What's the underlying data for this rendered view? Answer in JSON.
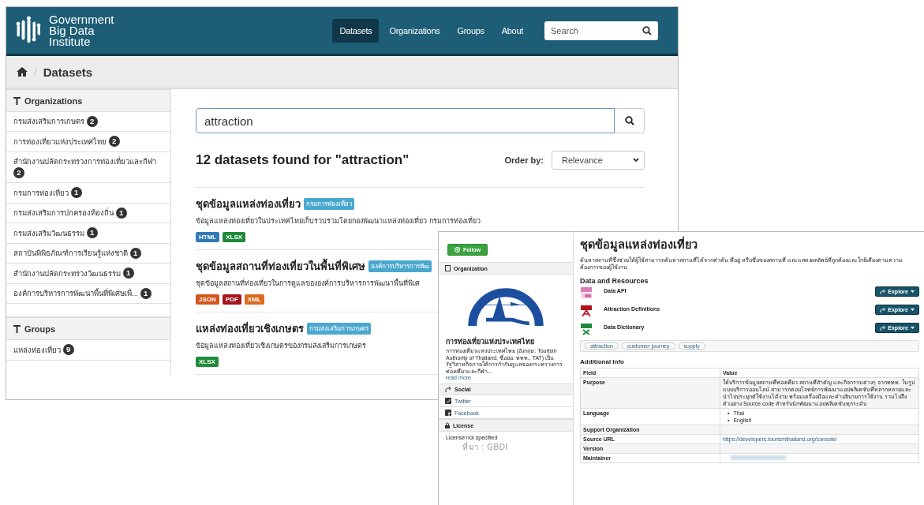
{
  "search_page": {
    "logo_lines": [
      "Government",
      "Big Data",
      "Institute"
    ],
    "nav": [
      {
        "label": "Datasets",
        "selected": true
      },
      {
        "label": "Organizations",
        "selected": false
      },
      {
        "label": "Groups",
        "selected": false
      },
      {
        "label": "About",
        "selected": false
      }
    ],
    "header_search": {
      "placeholder": "Search"
    },
    "breadcrumb": {
      "separator": "/",
      "current": "Datasets"
    },
    "facets": [
      {
        "title": "Organizations",
        "items": [
          {
            "label": "กรมส่งเสริมการเกษตร",
            "count": "2"
          },
          {
            "label": "การท่องเที่ยวแห่งประเทศไทย",
            "count": "2"
          },
          {
            "label": "สำนักงานปลัดกระทรวงการท่องเที่ยวและกีฬา",
            "count": "2"
          },
          {
            "label": "กรมการท่องเที่ยว",
            "count": "1"
          },
          {
            "label": "กรมส่งเสริมการปกครองท้องถิ่น",
            "count": "1"
          },
          {
            "label": "กรมส่งเสริมวัฒนธรรม",
            "count": "1"
          },
          {
            "label": "สถาบันพิพิธภัณฑ์การเรียนรู้แห่งชาติ",
            "count": "1"
          },
          {
            "label": "สำนักงานปลัดกระทรวงวัฒนธรรม",
            "count": "1"
          },
          {
            "label": "องค์การบริหารการพัฒนาพื้นที่พิเศษเพื่...",
            "count": "1"
          }
        ]
      },
      {
        "title": "Groups",
        "items": [
          {
            "label": "แหล่งท่องเที่ยว",
            "count": "9"
          }
        ]
      }
    ],
    "query": {
      "value": "attraction"
    },
    "result_count": "12 datasets found for \"attraction\"",
    "order_by": {
      "label": "Order by:",
      "value": "Relevance"
    },
    "datasets": [
      {
        "title": "ชุดข้อมูลแหล่งท่องเที่ยว",
        "organization": "กรมการท่องเที่ยว",
        "description": "ข้อมูลแหล่งท่องเที่ยวในประเทศไทยเก็บรวบรวมโดยกองพัฒนาแหล่งท่องเที่ยว กรมการท่องเที่ยว",
        "formats": [
          {
            "label": "HTML",
            "color": "#3279b5"
          },
          {
            "label": "XLSX",
            "color": "#1f8a3b"
          }
        ]
      },
      {
        "title": "ชุดข้อมูลสถานที่ท่องเที่ยวในพื้นที่พิเศษ",
        "organization": "องค์การบริหารการพัฒ",
        "description": "ชุดข้อมูลสถานที่ท่องเที่ยวในการดูแลขององค์การบริหารการพัฒนาพื้นที่พิเศ",
        "formats": [
          {
            "label": "JSON",
            "color": "#d4541c"
          },
          {
            "label": "PDF",
            "color": "#a3141c"
          },
          {
            "label": "XML",
            "color": "#dd6a1f"
          }
        ]
      },
      {
        "title": "แหล่งท่องเที่ยวเชิงเกษตร",
        "organization": "กรมส่งเสริมการเกษตร",
        "description": "ข้อมูลแหล่งท่องเที่ยวเชิงเกษตรของกรมส่งเสริมการเกษตร",
        "formats": [
          {
            "label": "XLSX",
            "color": "#1f8a3b"
          }
        ]
      }
    ]
  },
  "dataset_page": {
    "follow_button": "Follow",
    "organization": {
      "heading": "Organization",
      "name": "การท่องเที่ยวแห่งประเทศไทย",
      "description": "การท่องเที่ยวแห่งประเทศไทย (อังกฤษ: Tourism Authority of Thailand, ชื่อย่อ: ททท., TAT) เป็นรัฐวิสาหกิจภายใต้การกำกับดูแลของกระทรวงการท่องเที่ยวและกีฬา...",
      "read_more": "read more"
    },
    "social": {
      "heading": "Social",
      "links": [
        {
          "kind": "twitter",
          "label": "Twitter"
        },
        {
          "kind": "facebook",
          "label": "Facebook"
        }
      ]
    },
    "license": {
      "heading": "License",
      "text": "License not specified"
    },
    "source_note": "ที่มา : GBDI",
    "title": "ชุดข้อมูลแหล่งท่องเที่ยว",
    "description": "ค้นหาสถานที่ซึ่งช่วยให้ผู้ใช้สามารถค้นหาสถานที่ได้จากคำค้น ที่อยู่ หรือชื่อของสถานที่ และแสดงผลลัพธ์ที่ถูกต้องและใกล้เคียงตามความต้องการของผู้ใช้งาน",
    "resources_heading": "Data and Resources",
    "resources": [
      {
        "kind": "api",
        "name": "Data API",
        "button": "Explore"
      },
      {
        "kind": "pdf",
        "name": "Attraction Definitions",
        "button": "Explore"
      },
      {
        "kind": "xls",
        "name": "Data Dictionary",
        "button": "Explore"
      }
    ],
    "tags": [
      "attraction",
      "customer journey",
      "supply"
    ],
    "additional_info": {
      "heading": "Additional Info",
      "columns": [
        "Field",
        "Value"
      ],
      "rows": [
        {
          "field": "Purpose",
          "kind": "text",
          "value": "ให้บริการข้อมูลสถานที่ท่องเที่ยว สถานที่สำคัญ และกิจกรรมต่างๆ จากททท. ในรูปแบบบริการออนไลน์ สามารถตอบโจทย์การพัฒนาแอปพลิเคชันที่หลากหลายและนำไปประยุกต์ใช้งานได้ง่าย พร้อมเครื่องมือและคำอธิบายการใช้งาน รวมไปถึงตัวอย่าง Source code สำหรับนักพัฒนาแอปพลิเคชันทุกระดับ"
        },
        {
          "field": "Language",
          "kind": "list",
          "marker": "•",
          "items": [
            "Thai",
            "English"
          ]
        },
        {
          "field": "Support Organization",
          "kind": "empty"
        },
        {
          "field": "Source URL",
          "kind": "link",
          "value": "https://developers.tourismthailand.org/console/"
        },
        {
          "field": "Version",
          "kind": "empty"
        },
        {
          "field": "Maintainer",
          "kind": "blurred"
        }
      ]
    }
  }
}
